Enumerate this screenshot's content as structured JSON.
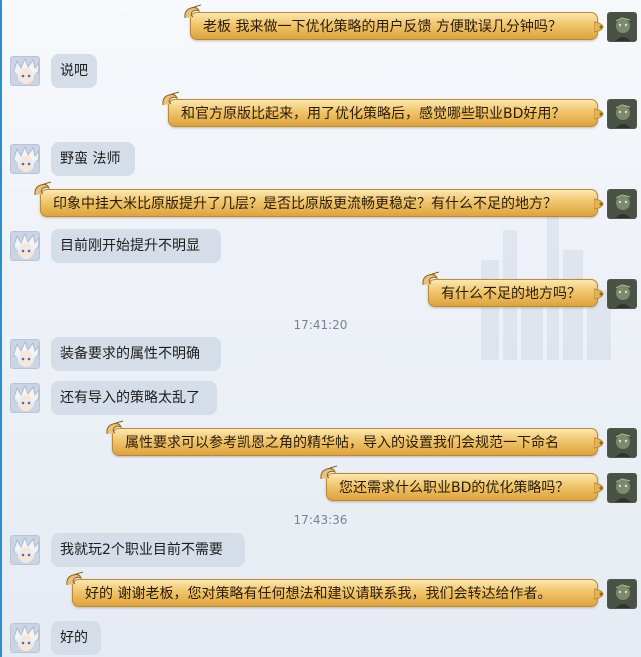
{
  "messages": [
    {
      "side": "right",
      "text": "老板  我来做一下优化策略的用户反馈 方便耽误几分钟吗？"
    },
    {
      "side": "left",
      "text": "说吧"
    },
    {
      "side": "right",
      "text": "和官方原版比起来，用了优化策略后，感觉哪些职业BD好用？"
    },
    {
      "side": "left",
      "text": "野蛮 法师"
    },
    {
      "side": "right",
      "text": "印象中挂大米比原版提升了几层？是否比原版更流畅更稳定？有什么不足的地方？"
    },
    {
      "side": "left",
      "text": "目前刚开始提升不明显"
    },
    {
      "side": "right",
      "text": "有什么不足的地方吗？"
    },
    {
      "side": "time",
      "text": "17:41:20"
    },
    {
      "side": "left",
      "text": "装备要求的属性不明确"
    },
    {
      "side": "left",
      "text": "还有导入的策略太乱了"
    },
    {
      "side": "right",
      "text": "属性要求可以参考凯恩之角的精华帖，导入的设置我们会规范一下命名"
    },
    {
      "side": "right",
      "text": "您还需求什么职业BD的优化策略吗？"
    },
    {
      "side": "time",
      "text": "17:43:36"
    },
    {
      "side": "left",
      "text": "我就玩2个职业目前不需要"
    },
    {
      "side": "right",
      "text": "好的  谢谢老板，您对策略有任何想法和建议请联系我，我们会转达给作者。"
    },
    {
      "side": "left",
      "text": "好的"
    }
  ],
  "colors": {
    "left_bubble": "#d5dde8",
    "right_bubble_gold": "#f0c56c",
    "timestamp": "#7a8290",
    "edge_accent": "#2a8fd0"
  },
  "icons": {
    "user_avatar": "user-avatar-icon",
    "agent_avatar": "agent-avatar-icon",
    "bubble_curl": "scroll-curl-icon"
  }
}
